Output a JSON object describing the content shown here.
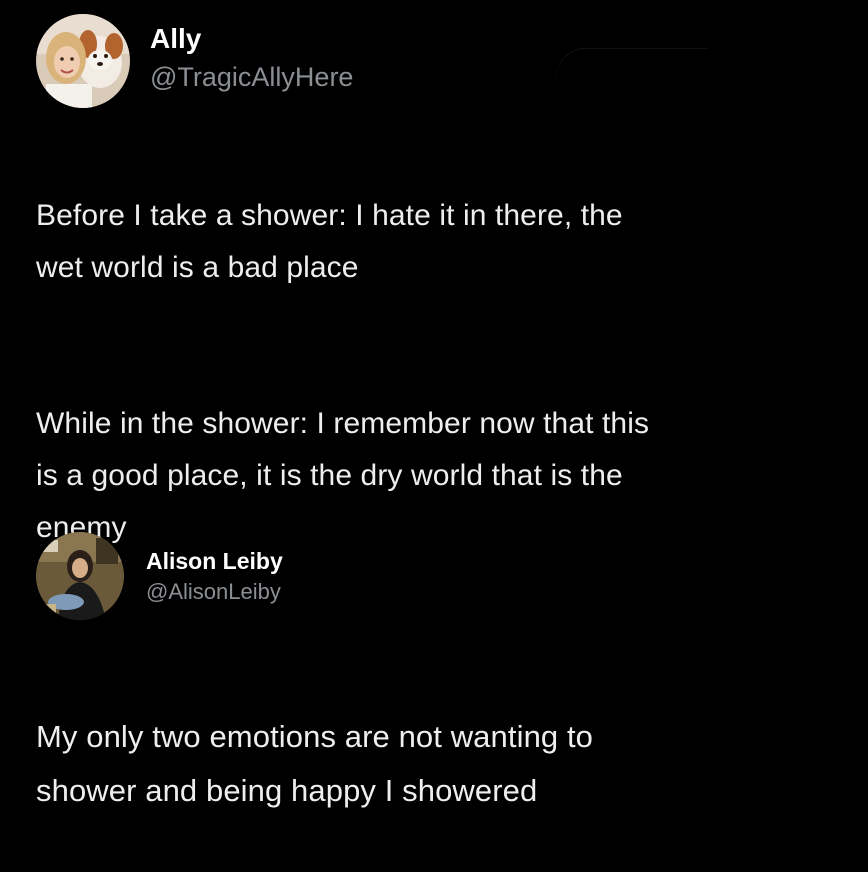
{
  "tweets": [
    {
      "display_name": "Ally",
      "handle": "@TragicAllyHere",
      "paragraphs": [
        "Before I take a shower: I hate it in there, the\nwet world is a bad place",
        "While in the shower: I remember now that this\nis a good place, it is the dry world that is the\nenemy"
      ]
    },
    {
      "display_name": "Alison Leiby",
      "handle": "@AlisonLeiby",
      "paragraphs": [
        "My only two emotions are not wanting to\nshower and being happy I showered"
      ]
    }
  ],
  "colors": {
    "background": "#000000",
    "name": "#ffffff",
    "handle": "#8b8f93",
    "text": "#eceeef"
  }
}
